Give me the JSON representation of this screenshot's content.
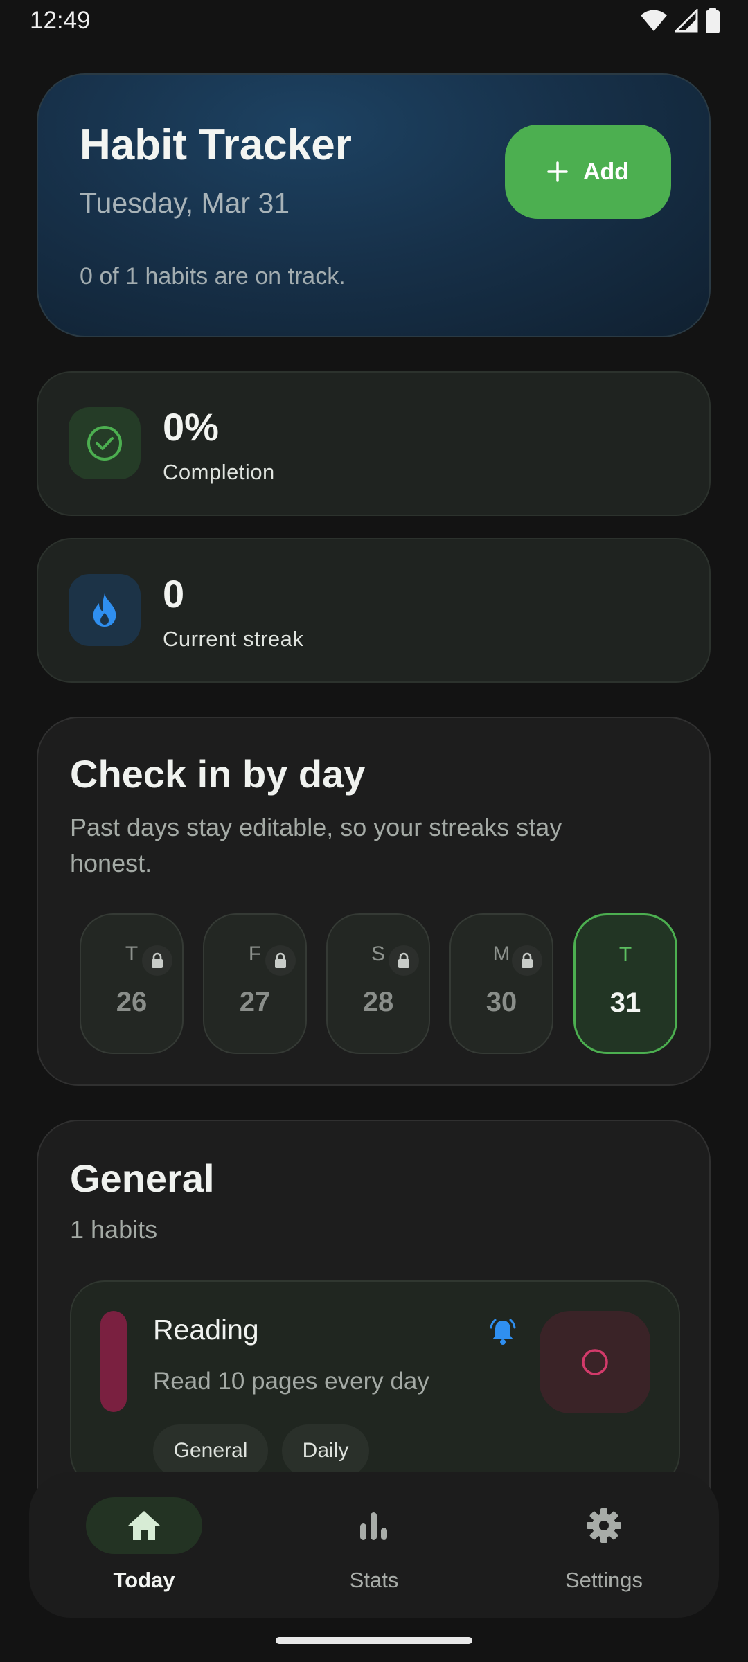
{
  "status_bar": {
    "time": "12:49"
  },
  "header": {
    "title": "Habit Tracker",
    "date": "Tuesday, Mar 31",
    "summary": "0 of 1 habits are on track.",
    "add_label": "Add"
  },
  "stats": {
    "completion": {
      "value": "0%",
      "label": "Completion"
    },
    "streak": {
      "value": "0",
      "label": "Current streak"
    }
  },
  "checkin": {
    "title": "Check in by day",
    "subtitle": "Past days stay editable, so your streaks stay honest.",
    "days": [
      {
        "letter": "T",
        "number": "26",
        "locked": true,
        "active": false
      },
      {
        "letter": "F",
        "number": "27",
        "locked": true,
        "active": false
      },
      {
        "letter": "S",
        "number": "28",
        "locked": true,
        "active": false
      },
      {
        "letter": "M",
        "number": "30",
        "locked": true,
        "active": false
      },
      {
        "letter": "T",
        "number": "31",
        "locked": false,
        "active": true
      }
    ]
  },
  "general": {
    "title": "General",
    "count": "1 habits",
    "habit": {
      "name": "Reading",
      "description": "Read 10 pages every day",
      "tags": [
        "General",
        "Daily"
      ],
      "color": "#7a2040"
    }
  },
  "nav": {
    "items": [
      {
        "label": "Today",
        "icon": "home-icon",
        "active": true
      },
      {
        "label": "Stats",
        "icon": "bar-chart-icon",
        "active": false
      },
      {
        "label": "Settings",
        "icon": "gear-icon",
        "active": false
      }
    ]
  },
  "colors": {
    "accent": "#4caf50",
    "streak_blue": "#2f8ff0",
    "habit_pink": "#d23a6a"
  }
}
